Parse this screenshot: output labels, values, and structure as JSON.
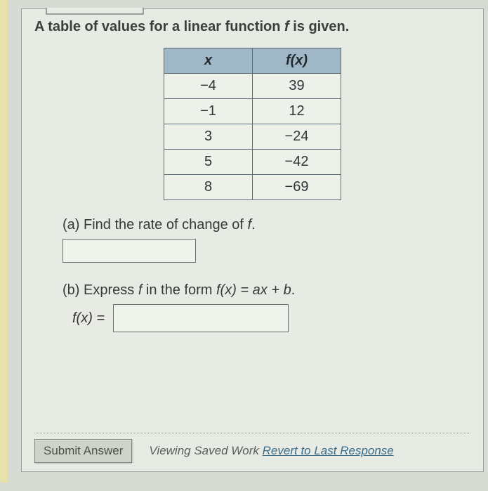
{
  "prompt": {
    "prefix": "A table of values for a linear function ",
    "fvar": "f",
    "suffix": " is given."
  },
  "table": {
    "header_x": "x",
    "header_fx": "f(x)",
    "rows": [
      {
        "x": "−4",
        "fx": "39"
      },
      {
        "x": "−1",
        "fx": "12"
      },
      {
        "x": "3",
        "fx": "−24"
      },
      {
        "x": "5",
        "fx": "−42"
      },
      {
        "x": "8",
        "fx": "−69"
      }
    ]
  },
  "part_a": {
    "label_prefix": "(a) Find the rate of change of ",
    "label_f": "f",
    "label_suffix": ".",
    "answer": ""
  },
  "part_b": {
    "label_prefix": "(b) Express ",
    "label_f": "f",
    "label_mid": " in the form  ",
    "label_form": "f(x) = ax + b",
    "label_suffix": ".",
    "lhs": "f(x) =",
    "answer": ""
  },
  "footer": {
    "submit": "Submit Answer",
    "saved_prefix": "Viewing Saved Work ",
    "revert": "Revert to Last Response"
  },
  "chart_data": {
    "type": "table",
    "columns": [
      "x",
      "f(x)"
    ],
    "rows": [
      [
        -4,
        39
      ],
      [
        -1,
        12
      ],
      [
        3,
        -24
      ],
      [
        5,
        -42
      ],
      [
        8,
        -69
      ]
    ],
    "title": "A table of values for a linear function f"
  }
}
